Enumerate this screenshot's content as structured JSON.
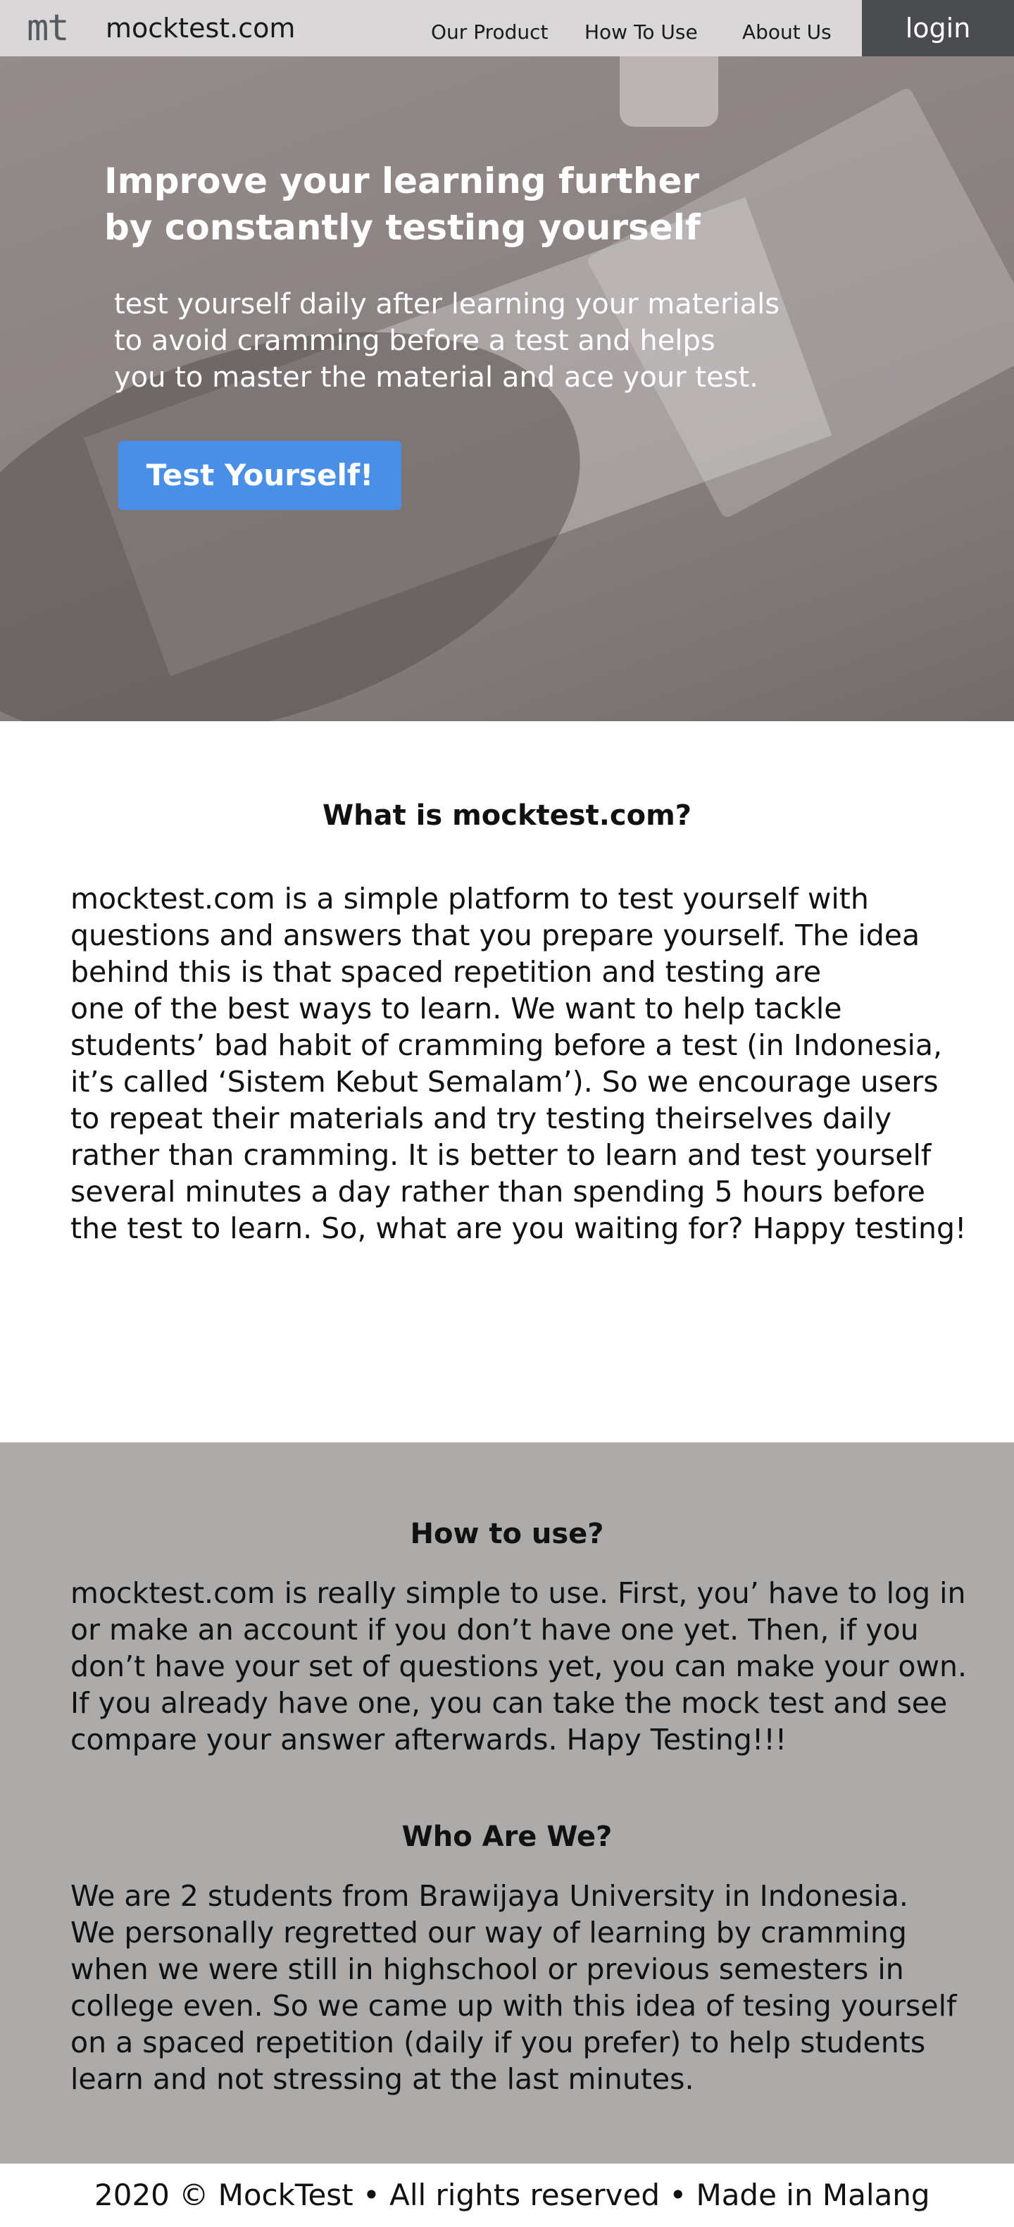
{
  "header": {
    "logo_mark": "mt",
    "site_name": "mocktest.com",
    "nav": {
      "our_product": "Our Product",
      "how_to_use": "How To Use",
      "about_us": "About Us"
    },
    "login": "login"
  },
  "hero": {
    "title_lines": [
      "Improve your learning further",
      "by constantly testing yourself"
    ],
    "desc_lines": [
      "test yourself daily after learning your materials",
      "to avoid cramming before a test and helps",
      "you to master the material and ace your test."
    ],
    "cta": "Test Yourself!"
  },
  "what": {
    "heading": "What is mocktest.com?",
    "lines": [
      "mocktest.com is a simple platform to test yourself with",
      "questions and answers that you prepare yourself. The idea",
      "behind this is that spaced repetition and testing are",
      "one of the best ways to learn. We want to help tackle",
      "students’ bad habit of cramming before a test (in Indonesia,",
      "it’s called ‘Sistem Kebut Semalam’). So we encourage users",
      "to repeat their materials and try testing theirselves daily",
      "rather than cramming. It is better to learn and test yourself",
      "several minutes a day rather than spending 5 hours before",
      "the test to learn. So, what are you waiting for? Happy testing!"
    ]
  },
  "how": {
    "heading": "How to use?",
    "lines": [
      "mocktest.com is really simple to use. First, you’ have to log in",
      "or make an account if you don’t have one yet. Then, if you",
      "don’t have your set of questions yet, you can make your own.",
      "If you already have one, you can take the mock test and see",
      "compare your answer afterwards. Hapy Testing!!!"
    ]
  },
  "who": {
    "heading": "Who Are We?",
    "lines": [
      "We are 2 students from Brawijaya University in Indonesia.",
      "We personally regretted our way of learning by cramming",
      "when we were still in highschool or previous semesters in",
      "college even. So we came up with this idea of tesing yourself",
      "on a spaced repetition (daily if you prefer) to help students",
      "learn and not stressing at the last minutes."
    ]
  },
  "footer": {
    "text": "2020 © MockTest • All rights reserved • Made in Malang"
  }
}
